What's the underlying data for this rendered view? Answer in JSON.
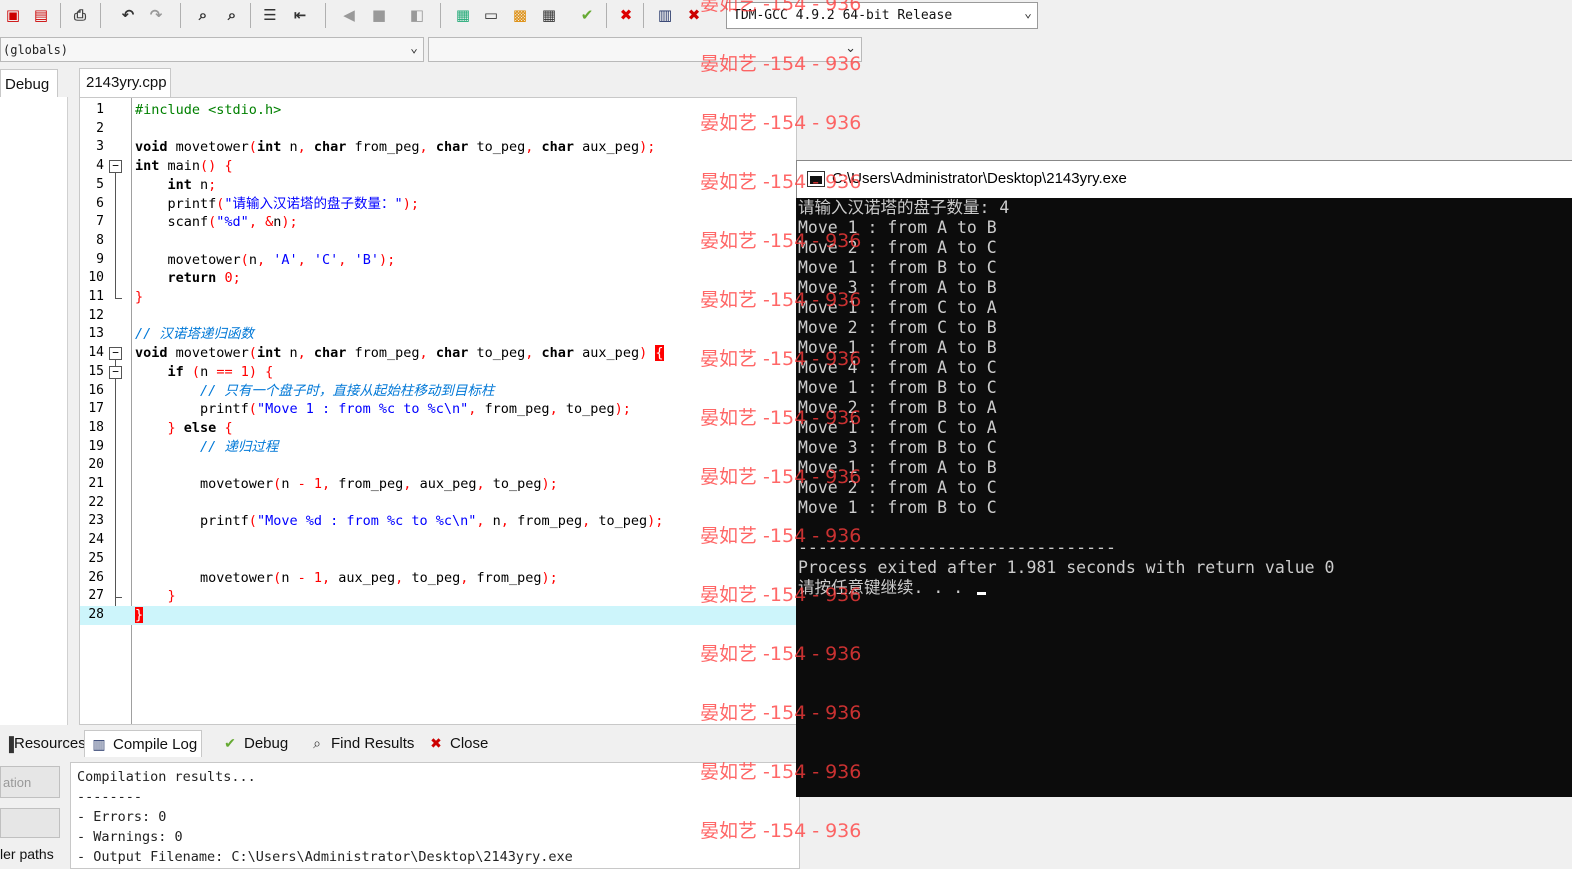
{
  "toolbar": {
    "compiler": "TDM-GCC 4.9.2 64-bit Release",
    "icons": [
      "project-icon",
      "close-project-icon",
      "print-icon",
      "undo-icon",
      "redo-icon",
      "find-icon",
      "replace-icon",
      "indent-icon",
      "unindent-icon",
      "goto-icon",
      "bookmark-icon",
      "comment-icon",
      "new-class-icon",
      "window-icon",
      "insert-icon",
      "layout-icon",
      "check-icon",
      "delete-icon",
      "chart-icon",
      "run-icon"
    ]
  },
  "scope": {
    "selected": "(globals)"
  },
  "left_panel": {
    "tab": "Debug"
  },
  "editor": {
    "file_tab": "2143yry.cpp",
    "current_line": 28,
    "lines": [
      "#include <stdio.h>",
      "",
      "void movetower(int n, char from_peg, char to_peg, char aux_peg);",
      "int main() {",
      "    int n;",
      "    printf(\"请输入汉诺塔的盘子数量：\");",
      "    scanf(\"%d\", &n);",
      "",
      "    movetower(n, 'A', 'C', 'B');",
      "    return 0;",
      "}",
      "",
      "// 汉诺塔递归函数",
      "void movetower(int n, char from_peg, char to_peg, char aux_peg) {",
      "    if (n == 1) {",
      "        // 只有一个盘子时，直接从起始柱移动到目标柱",
      "        printf(\"Move 1 : from %c to %c\\n\", from_peg, to_peg);",
      "    } else {",
      "        // 递归过程",
      "",
      "        movetower(n - 1, from_peg, aux_peg, to_peg);",
      "",
      "        printf(\"Move %d : from %c to %c\\n\", n, from_peg, to_peg);",
      "",
      "",
      "        movetower(n - 1, aux_peg, to_peg, from_peg);",
      "    }",
      "}"
    ]
  },
  "bottom": {
    "tabs": [
      {
        "label": "Resources",
        "icon": "resources-icon"
      },
      {
        "label": "Compile Log",
        "icon": "chart-icon"
      },
      {
        "label": "Debug",
        "icon": "check-icon"
      },
      {
        "label": "Find Results",
        "icon": "find-icon"
      },
      {
        "label": "Close",
        "icon": "close-icon"
      }
    ],
    "side_buttons": [
      "ation",
      ""
    ],
    "side_paths": "ler paths",
    "log": [
      "Compilation results...",
      "--------",
      "- Errors: 0",
      "- Warnings: 0",
      "- Output Filename: C:\\Users\\Administrator\\Desktop\\2143yry.exe"
    ]
  },
  "console": {
    "title": "C:\\Users\\Administrator\\Desktop\\2143yry.exe",
    "lines": [
      "请输入汉诺塔的盘子数量: 4",
      "Move 1 : from A to B",
      "Move 2 : from A to C",
      "Move 1 : from B to C",
      "Move 3 : from A to B",
      "Move 1 : from C to A",
      "Move 2 : from C to B",
      "Move 1 : from A to B",
      "Move 4 : from A to C",
      "Move 1 : from B to C",
      "Move 2 : from B to A",
      "Move 1 : from C to A",
      "Move 3 : from B to C",
      "Move 1 : from A to B",
      "Move 2 : from A to C",
      "Move 1 : from B to C",
      "",
      "--------------------------------",
      "Process exited after 1.981 seconds with return value 0",
      "请按任意键继续. . . "
    ]
  },
  "watermark": {
    "text": "晏如艺 -154 - 936"
  },
  "colors": {
    "accent_current_line": "#cdf5fb",
    "console_bg": "#0c0c0c",
    "watermark": "#ff3c3c"
  }
}
